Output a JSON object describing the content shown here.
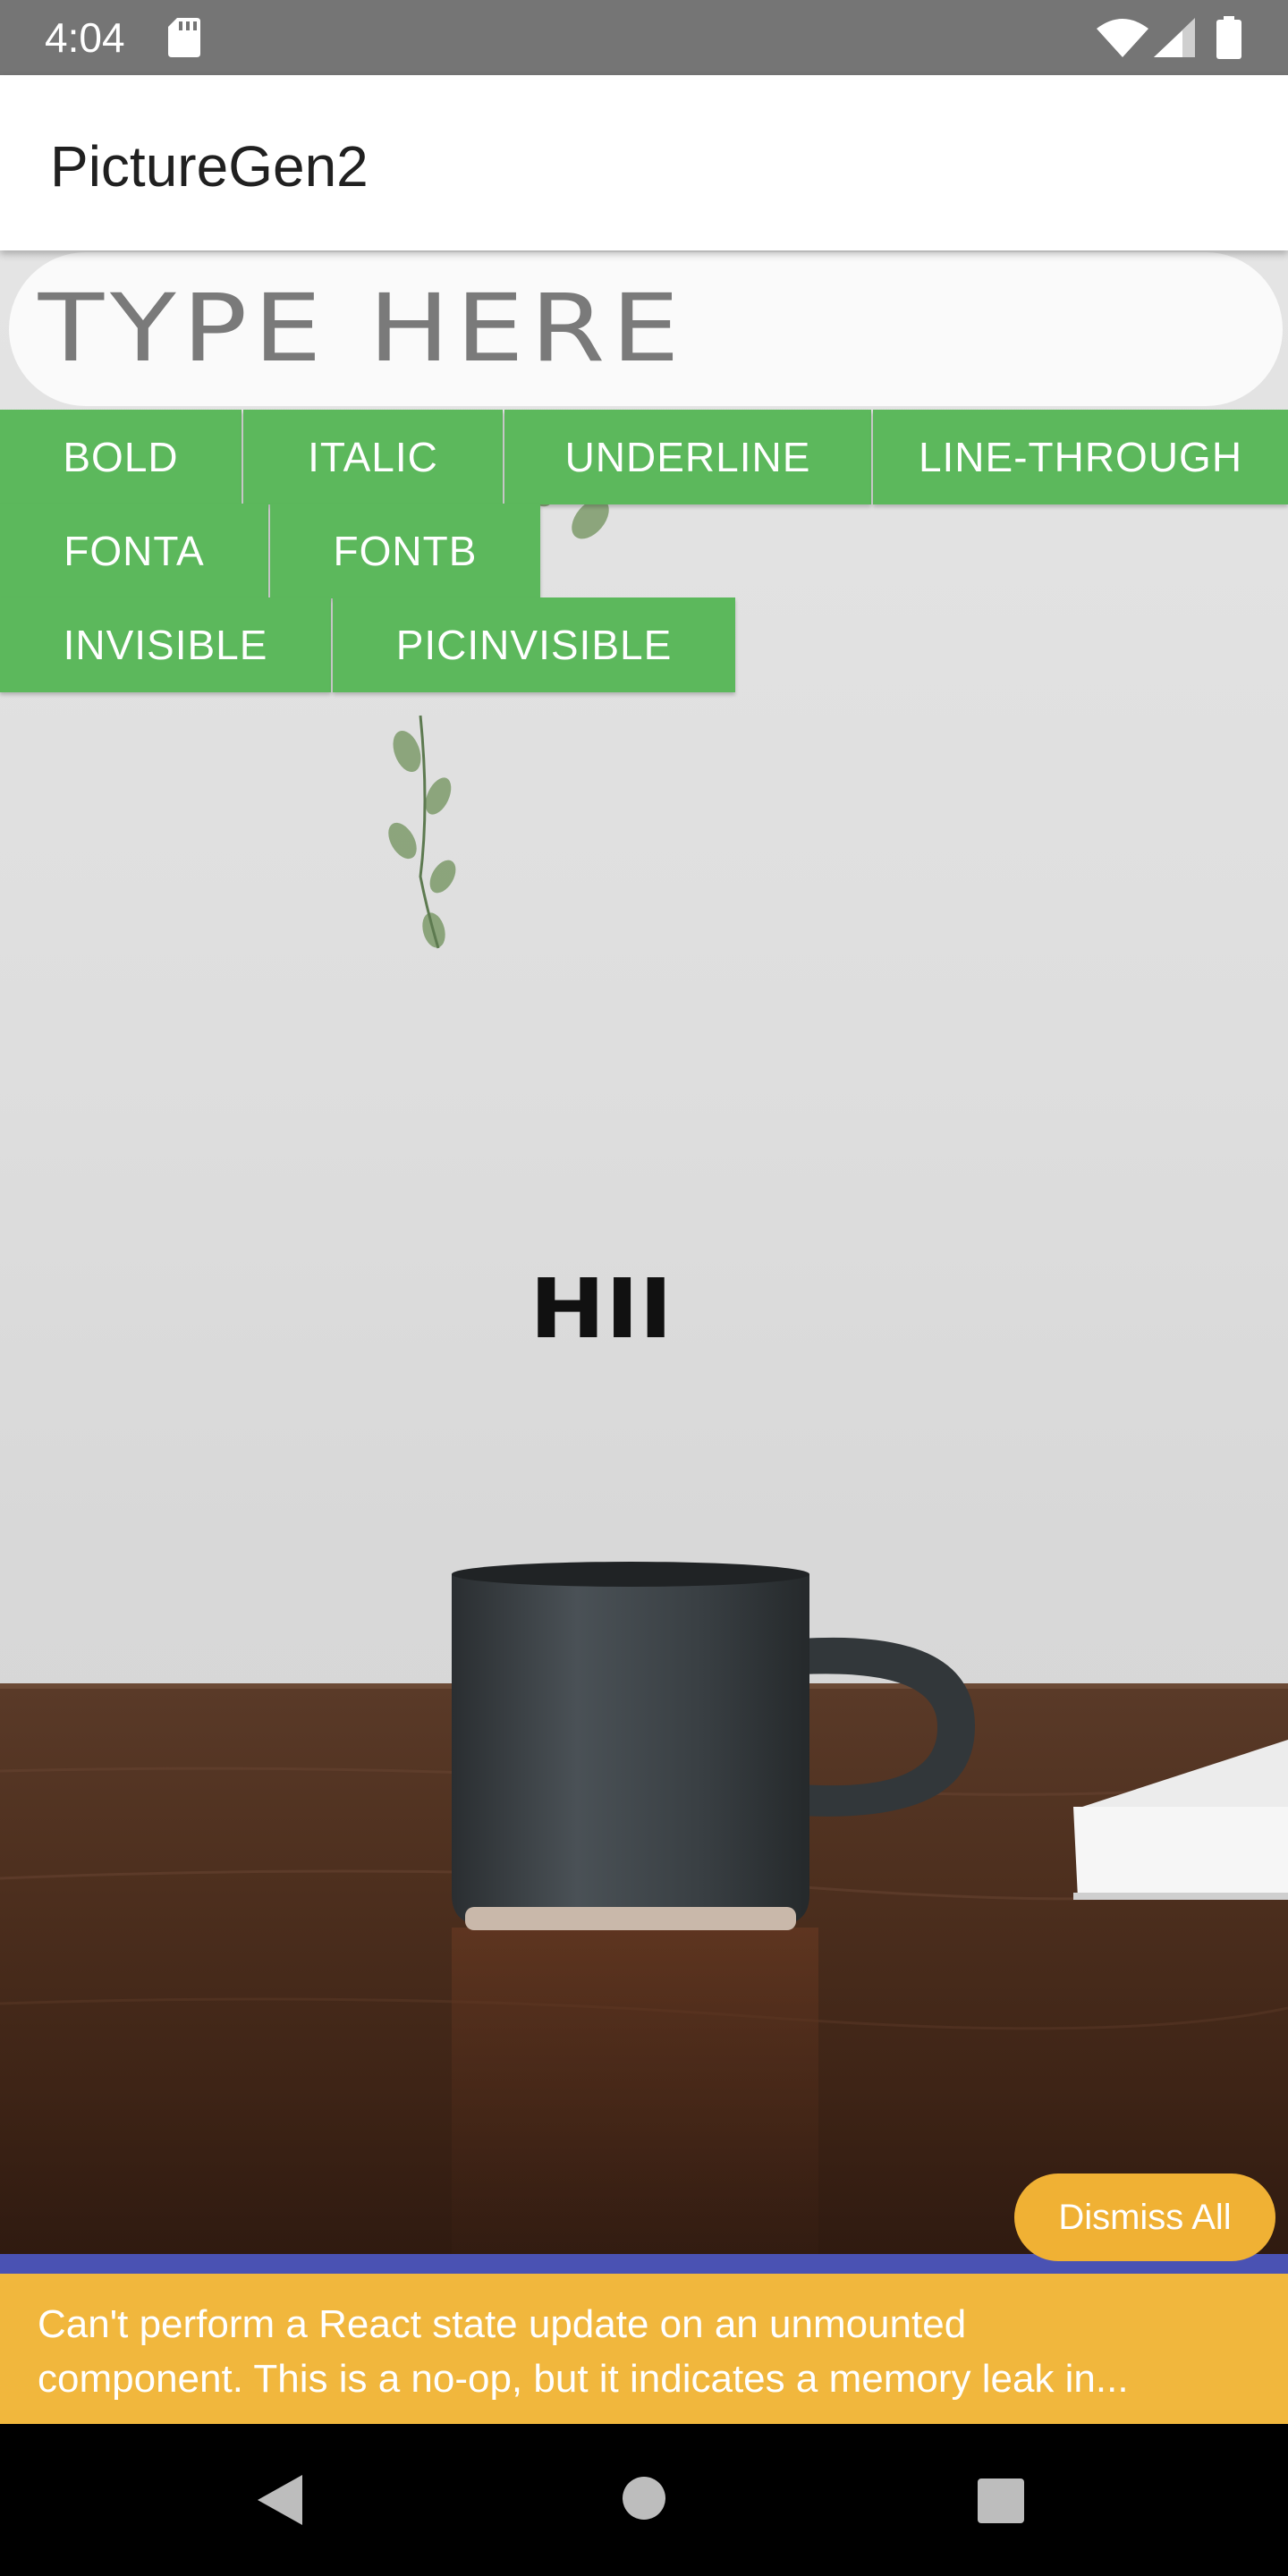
{
  "status_bar": {
    "time": "4:04",
    "icons": [
      "sd-card-icon",
      "wifi-icon",
      "cell-signal-icon",
      "battery-icon"
    ]
  },
  "app_bar": {
    "title": "PictureGen2"
  },
  "editor": {
    "input_placeholder": "TYPE HERE",
    "input_value": "",
    "buttons": {
      "bold": "BOLD",
      "italic": "ITALIC",
      "underline": "UNDERLINE",
      "line_through": "LINE-THROUGH",
      "fonta": "FONTA",
      "fontb": "FONTB",
      "invisible": "INVISIBLE",
      "picinvisible": "PICINVISIBLE"
    },
    "overlay_text": "HII"
  },
  "warning": {
    "dismiss_label": "Dismiss All",
    "message_line1": "Can't perform a React state update on an unmounted",
    "message_line2": "component. This is a no-op, but it indicates a memory leak in..."
  },
  "nav_bar": {
    "icons": [
      "back-icon",
      "home-icon",
      "recents-icon"
    ]
  },
  "colors": {
    "status_bar": "#757575",
    "button_green": "#5cb85c",
    "toast_yellow": "#f1b73d",
    "tab_strip": "#4a52b3"
  }
}
